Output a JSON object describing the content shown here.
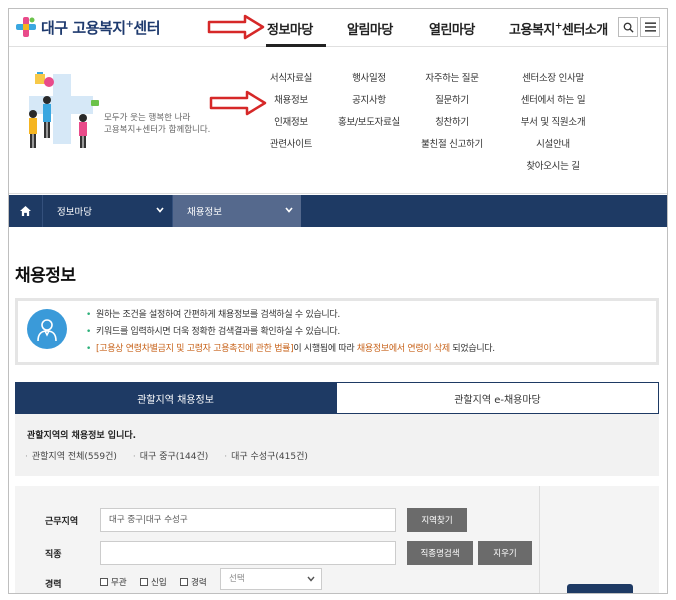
{
  "header": {
    "logo_text": "대구 고용복지",
    "logo_sup": "+",
    "logo_suffix": "센터",
    "nav": [
      {
        "label": "정보마당"
      },
      {
        "label": "알림마당"
      },
      {
        "label": "열린마당"
      },
      {
        "label_pre": "고용복지",
        "label_sup": "+",
        "label_post": "센터소개"
      }
    ],
    "search_icon": "search-icon",
    "menu_icon": "hamburger-menu-icon"
  },
  "mega_menu": {
    "slogan_line1": "모두가 웃는 행복한 나라",
    "slogan_line2": "고용복지+센터가 함께합니다.",
    "columns": [
      [
        "서식자료실",
        "채용정보",
        "인재정보",
        "관련사이트"
      ],
      [
        "행사일정",
        "공지사항",
        "홍보/보도자료실"
      ],
      [
        "자주하는 질문",
        "질문하기",
        "칭찬하기",
        "불친절 신고하기"
      ],
      [
        "센터소장 인사말",
        "센터에서 하는 일",
        "부서 및 직원소개",
        "시설안내",
        "찾아오시는 길"
      ]
    ]
  },
  "breadcrumb": {
    "home_icon": "home-icon",
    "level1": "정보마당",
    "level2": "채용정보"
  },
  "page_title": "채용정보",
  "notice": {
    "icon": "person-icon",
    "line1": "원하는 조건을 설정하여 간편하게 채용정보를 검색하실 수 있습니다.",
    "line2": "키워드를 입력하시면 더욱 정확한 검색결과를 확인하실 수 있습니다.",
    "line3_a": "[고용상 연령차별금지 및 고령자 고용촉진에 관한 법률]",
    "line3_b": "이 시행됨에 따라 ",
    "line3_c": "채용정보에서 연령이 삭제",
    "line3_d": " 되었습니다."
  },
  "tabs": [
    {
      "label": "관할지역 채용정보",
      "active": true
    },
    {
      "label": "관할지역 e-채용마당",
      "active": false
    }
  ],
  "region": {
    "title": "관할지역의 채용정보 입니다.",
    "links": [
      "관할지역 전체(559건)",
      "대구 중구(144건)",
      "대구 수성구(415건)"
    ]
  },
  "search_form": {
    "work_area_label": "근무지역",
    "work_area_value": "대구 중구|대구 수성구",
    "find_area_button": "지역찾기",
    "job_type_label": "직종",
    "job_type_value": "",
    "job_search_button": "직종명검색",
    "clear_button": "지우기",
    "career_label": "경력",
    "career_options": [
      "무관",
      "신입",
      "경력"
    ],
    "career_select": "선택"
  },
  "colors": {
    "navy": "#1e3a64",
    "accent_orange": "#c8641c",
    "bullet_green": "#2db07a",
    "arrow_red": "#d62828"
  }
}
